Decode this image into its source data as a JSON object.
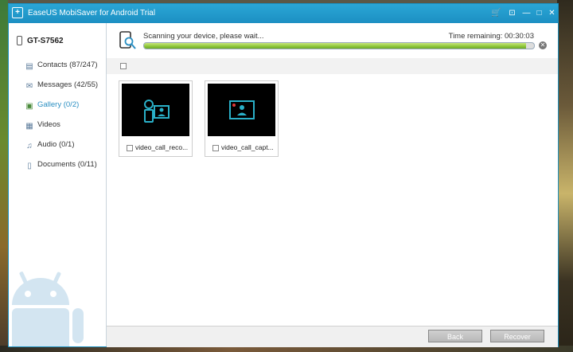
{
  "window": {
    "title": "EaseUS MobiSaver for Android Trial",
    "controls": {
      "cart": "🛒",
      "restore_down": "⊡",
      "minimize": "—",
      "maximize": "□",
      "close": "✕"
    },
    "accent": "#1c8fc2"
  },
  "sidebar": {
    "device": "GT-S7562",
    "items": [
      {
        "label": "Contacts",
        "count": "(87/247)",
        "icon": "contacts-icon"
      },
      {
        "label": "Messages",
        "count": "(42/55)",
        "icon": "messages-icon"
      },
      {
        "label": "Gallery",
        "count": "(0/2)",
        "icon": "gallery-icon",
        "active": true
      },
      {
        "label": "Videos",
        "count": "",
        "icon": "videos-icon"
      },
      {
        "label": "Audio",
        "count": "(0/1)",
        "icon": "audio-icon"
      },
      {
        "label": "Documents",
        "count": "(0/11)",
        "icon": "documents-icon"
      }
    ]
  },
  "scan": {
    "status": "Scanning your device, please wait...",
    "time_remaining": "Time remaining: 00:30:03",
    "progress_pct": 98
  },
  "gallery": {
    "files": [
      {
        "name": "video_call_reco...",
        "icon": "video-call-record-icon"
      },
      {
        "name": "video_call_capt...",
        "icon": "video-call-capture-icon"
      }
    ]
  },
  "footer": {
    "back_label": "Back",
    "recover_label": "Recover"
  }
}
